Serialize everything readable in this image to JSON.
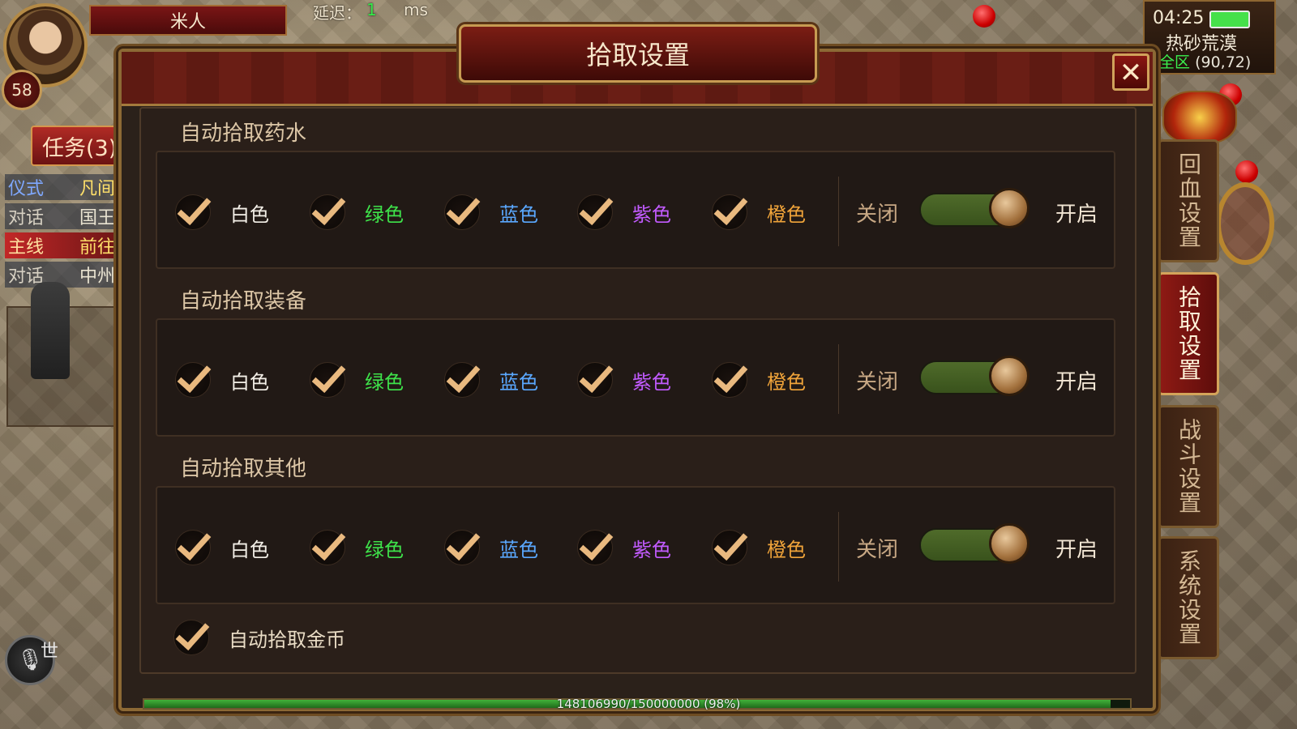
{
  "hud": {
    "player_name": "米人",
    "level": "58",
    "latency_label": "延迟：",
    "latency_value": "1",
    "latency_unit": "ms",
    "tasks_button": "任务(3)",
    "quests": [
      {
        "type": "仪式",
        "text": "凡间"
      },
      {
        "type": "对话",
        "text": "国王"
      },
      {
        "type": "主线",
        "text": "前往"
      },
      {
        "type": "对话",
        "text": "中州"
      }
    ],
    "world_chat": "世"
  },
  "status": {
    "time": "04:25",
    "map_name": "热砂荒漠",
    "zone": "全区",
    "coords": "(90,72)"
  },
  "side_tabs": [
    {
      "label": "回血设置",
      "active": false
    },
    {
      "label": "拾取设置",
      "active": true
    },
    {
      "label": "战斗设置",
      "active": false
    },
    {
      "label": "系统设置",
      "active": false
    }
  ],
  "dialog": {
    "title": "拾取设置",
    "close_icon": "close-icon",
    "sections": [
      {
        "title": "自动拾取药水",
        "options": [
          {
            "label": "白色",
            "checked": true
          },
          {
            "label": "绿色",
            "checked": true
          },
          {
            "label": "蓝色",
            "checked": true
          },
          {
            "label": "紫色",
            "checked": true
          },
          {
            "label": "橙色",
            "checked": true
          }
        ],
        "toggle_off": "关闭",
        "toggle_on": "开启",
        "toggle_state": "on"
      },
      {
        "title": "自动拾取装备",
        "options": [
          {
            "label": "白色",
            "checked": true
          },
          {
            "label": "绿色",
            "checked": true
          },
          {
            "label": "蓝色",
            "checked": true
          },
          {
            "label": "紫色",
            "checked": true
          },
          {
            "label": "橙色",
            "checked": true
          }
        ],
        "toggle_off": "关闭",
        "toggle_on": "开启",
        "toggle_state": "on"
      },
      {
        "title": "自动拾取其他",
        "options": [
          {
            "label": "白色",
            "checked": true
          },
          {
            "label": "绿色",
            "checked": true
          },
          {
            "label": "蓝色",
            "checked": true
          },
          {
            "label": "紫色",
            "checked": true
          },
          {
            "label": "橙色",
            "checked": true
          }
        ],
        "toggle_off": "关闭",
        "toggle_on": "开启",
        "toggle_state": "on"
      }
    ],
    "gold": {
      "label": "自动拾取金币",
      "checked": true
    }
  },
  "xp": {
    "text": "148106990/150000000 (98%)",
    "fraction": 0.98
  },
  "colors": {
    "white": "#f3efe7",
    "green": "#3ee24a",
    "blue": "#5aa8ff",
    "purple": "#c25bff",
    "orange": "#f0a43a"
  }
}
